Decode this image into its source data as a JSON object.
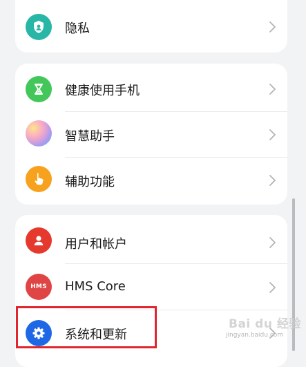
{
  "groups": [
    {
      "items": [
        {
          "label": "隐私",
          "icon": "privacy-shield-icon",
          "color": "#28b6a6"
        }
      ]
    },
    {
      "items": [
        {
          "label": "健康使用手机",
          "icon": "hourglass-icon",
          "color": "#43c75a"
        },
        {
          "label": "智慧助手",
          "icon": "assistant-orb-icon",
          "color": "#f29ac1"
        },
        {
          "label": "辅助功能",
          "icon": "hand-pointer-icon",
          "color": "#f7a21e"
        }
      ]
    },
    {
      "items": [
        {
          "label": "用户和帐户",
          "icon": "user-icon",
          "color": "#e5392e"
        },
        {
          "label": "HMS Core",
          "icon": "hms-icon",
          "color": "#df4545",
          "icon_text": "HMS"
        },
        {
          "label": "系统和更新",
          "icon": "gear-icon",
          "color": "#1f68e5"
        }
      ]
    }
  ],
  "watermark": {
    "brand": "Bai du 经验",
    "url": "jingyan.baidu.com"
  },
  "highlight_color": "#e1252d"
}
